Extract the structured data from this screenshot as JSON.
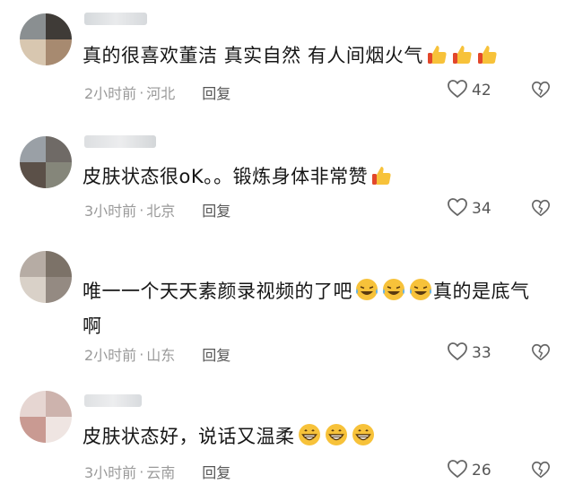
{
  "comments": [
    {
      "text": "真的很喜欢董洁  真实自然 有人间烟火气",
      "emoji": [
        "thumbs-up-icon",
        "thumbs-up-icon",
        "thumbs-up-icon"
      ],
      "time": "2小时前",
      "location": "河北",
      "reply_label": "回复",
      "likes": "42"
    },
    {
      "text": "皮肤状态很oK。。锻炼身体非常赞",
      "emoji": [
        "thumbs-up-icon"
      ],
      "time": "3小时前",
      "location": "北京",
      "reply_label": "回复",
      "likes": "34"
    },
    {
      "text": "唯一一个天天素颜录视频的了吧",
      "emoji": [
        "rolling-laughing-icon",
        "rolling-laughing-icon",
        "rolling-laughing-icon"
      ],
      "text_after": "真的是底气啊",
      "time": "2小时前",
      "location": "山东",
      "reply_label": "回复",
      "likes": "33"
    },
    {
      "text": "皮肤状态好，说话又温柔",
      "emoji": [
        "grinning-face-icon",
        "grinning-face-icon",
        "grinning-face-icon"
      ],
      "time": "3小时前",
      "location": "云南",
      "reply_label": "回复",
      "likes": "26"
    }
  ],
  "meta_separator": "·",
  "colors": {
    "text": "#161616",
    "meta": "#9a9a9a",
    "icon": "#666666",
    "emoji_yellow": "#f7c23a",
    "emoji_red": "#e2472b"
  }
}
